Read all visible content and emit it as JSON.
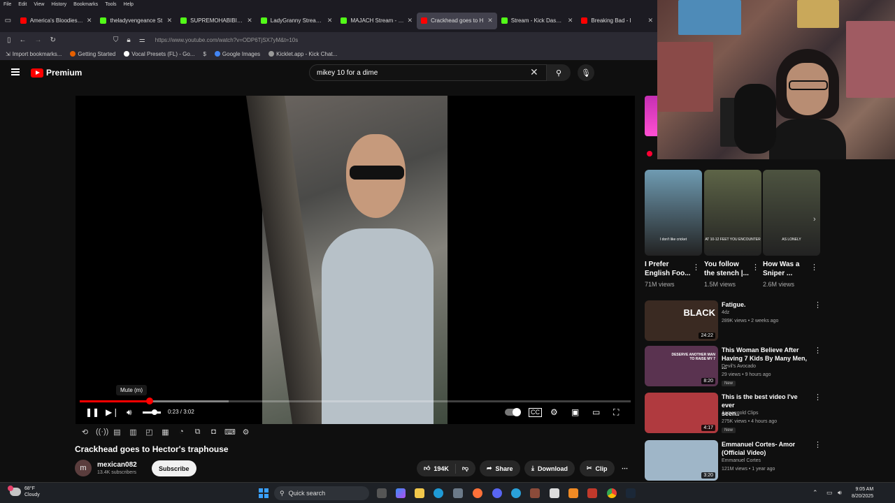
{
  "browser": {
    "menu": [
      "File",
      "Edit",
      "View",
      "History",
      "Bookmarks",
      "Tools",
      "Help"
    ],
    "tabs": [
      {
        "title": "America's Bloodiest Day:",
        "color": "#ff0000"
      },
      {
        "title": "theladyvengeance St",
        "color": "#53fc18"
      },
      {
        "title": "SUPREMOHABIBI Stream",
        "color": "#53fc18"
      },
      {
        "title": "LadyGranny Stream · Wa",
        "color": "#53fc18"
      },
      {
        "title": "MAJACH Stream - Watch",
        "color": "#53fc18"
      },
      {
        "title": "Crackhead goes to H",
        "color": "#ff0000",
        "active": true
      },
      {
        "title": "Stream - Kick Dashboard",
        "color": "#53fc18"
      },
      {
        "title": "Breaking Bad - I",
        "color": "#ff0000"
      }
    ],
    "url": "https://www.youtube.com/watch?v=ODP6TjSX7yM&t=10s",
    "bookmarks": [
      "Import bookmarks...",
      "Getting Started",
      "Vocal Presets (FL) - Go...",
      "Google Images",
      "Kicklet.app - Kick Chat..."
    ]
  },
  "youtube": {
    "logo_text": "Premium",
    "search_query": "mikey 10 for a dime"
  },
  "player": {
    "tooltip": "Mute (m)",
    "time_display": "0:23 / 3:02",
    "progress_fraction": 0.127,
    "buffered_fraction": 0.27,
    "volume_fraction": 0.6
  },
  "video": {
    "title": "Crackhead goes to Hector's traphouse",
    "channel_initial": "m",
    "channel_name": "mexican082",
    "subscribers": "13.4K subscribers",
    "subscribe_label": "Subscribe",
    "likes": "194K",
    "share_label": "Share",
    "download_label": "Download",
    "clip_label": "Clip",
    "more_label": "⋯"
  },
  "shorts": [
    {
      "title_line1": "I Prefer",
      "title_line2": "English Foo...",
      "views": "71M views",
      "caption": "I don't like cricket",
      "bg": "#6f9bb2"
    },
    {
      "title_line1": "You follow",
      "title_line2": "the stench |...",
      "views": "1.5M views",
      "caption": "AT 10-12 FEET YOU ENCOUNTER",
      "bg": "#5d6447"
    },
    {
      "title_line1": "How Was a",
      "title_line2": "Sniper ...",
      "views": "2.6M views",
      "caption": "AS LONELY",
      "bg": "#4d5340"
    }
  ],
  "recommended": [
    {
      "title_line1": "Fatigue.",
      "title_line2": "",
      "channel": "4dz",
      "meta": "289K views • 2 weeks ago",
      "duration": "24:22",
      "thumb_text": "BLACK",
      "new": false,
      "bg": "#3a2a22"
    },
    {
      "title_line1": "This Woman Believe After",
      "title_line2": "Having 7 Kids By Many Men, ...",
      "channel": "Devil's Avocado",
      "meta": "29 views • 9 hours ago",
      "duration": "8:20",
      "thumb_text": "DESERVE ANOTHER MAN TO RAISE MY 7",
      "new": true,
      "bg": "#5a3350"
    },
    {
      "title_line1": "This is the best video I've ever",
      "title_line2": "seen..",
      "channel": "Asmongold Clips",
      "meta": "275K views • 4 hours ago",
      "duration": "4:17",
      "thumb_text": "",
      "new": true,
      "bg": "#b03a3f"
    },
    {
      "title_line1": "Emmanuel Cortes- Amor",
      "title_line2": "(Official Video)",
      "channel": "Emmanuel Cortes",
      "meta": "121M views • 1 year ago",
      "duration": "3:20",
      "thumb_text": "",
      "new": false,
      "bg": "#9fb6c8"
    }
  ],
  "taskbar": {
    "temperature": "68°F",
    "condition": "Cloudy",
    "search_label": "Quick search",
    "time": "9:05 AM",
    "date": "8/20/2025"
  }
}
